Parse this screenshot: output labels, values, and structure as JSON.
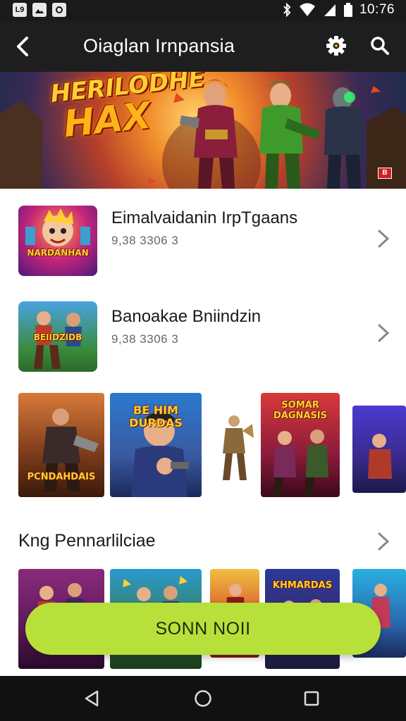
{
  "status_bar": {
    "left_icons": [
      "L9",
      "image-icon",
      "notification-icon"
    ],
    "time": "10:76",
    "icons": [
      "bluetooth-icon",
      "wifi-icon",
      "signal-icon",
      "battery-icon"
    ]
  },
  "app_bar": {
    "title": "Oiaglan Irnpansia",
    "back_icon": "back-arrow-icon",
    "settings_icon": "gear-icon",
    "search_icon": "search-icon"
  },
  "banner": {
    "title_line1": "HERILODHE",
    "title_line2": "HAX",
    "badge": "B"
  },
  "list": [
    {
      "title": "Eimalvaidanin IrpTgaans",
      "subtitle": "9,38 3306 3",
      "thumb_label": "NARDANHAN"
    },
    {
      "title": "Banoakae Bniindzin",
      "subtitle": "9,38 3306 3",
      "thumb_label": "BEIIDZIDB"
    }
  ],
  "carousel_1": [
    {
      "label": "PCNDAHDAIS"
    },
    {
      "label": "BE HIM DURDAS"
    },
    {
      "label": ""
    },
    {
      "label": "SOMAR DAGNASIS"
    },
    {
      "label": ""
    }
  ],
  "section": {
    "title": "Kng Pennarlilciae"
  },
  "carousel_2": [
    {
      "label": ""
    },
    {
      "label": ""
    },
    {
      "label": ""
    },
    {
      "label": "KHMARDAS"
    },
    {
      "label": ""
    }
  ],
  "cta": {
    "label": "SONN NOII"
  },
  "nav": {
    "back_icon": "nav-back-icon",
    "home_icon": "nav-home-icon",
    "recents_icon": "nav-recents-icon"
  },
  "colors": {
    "app_bar": "#1e1e1e",
    "cta": "#b7e03a",
    "nav_bar": "#111111",
    "chevron": "#888888"
  }
}
